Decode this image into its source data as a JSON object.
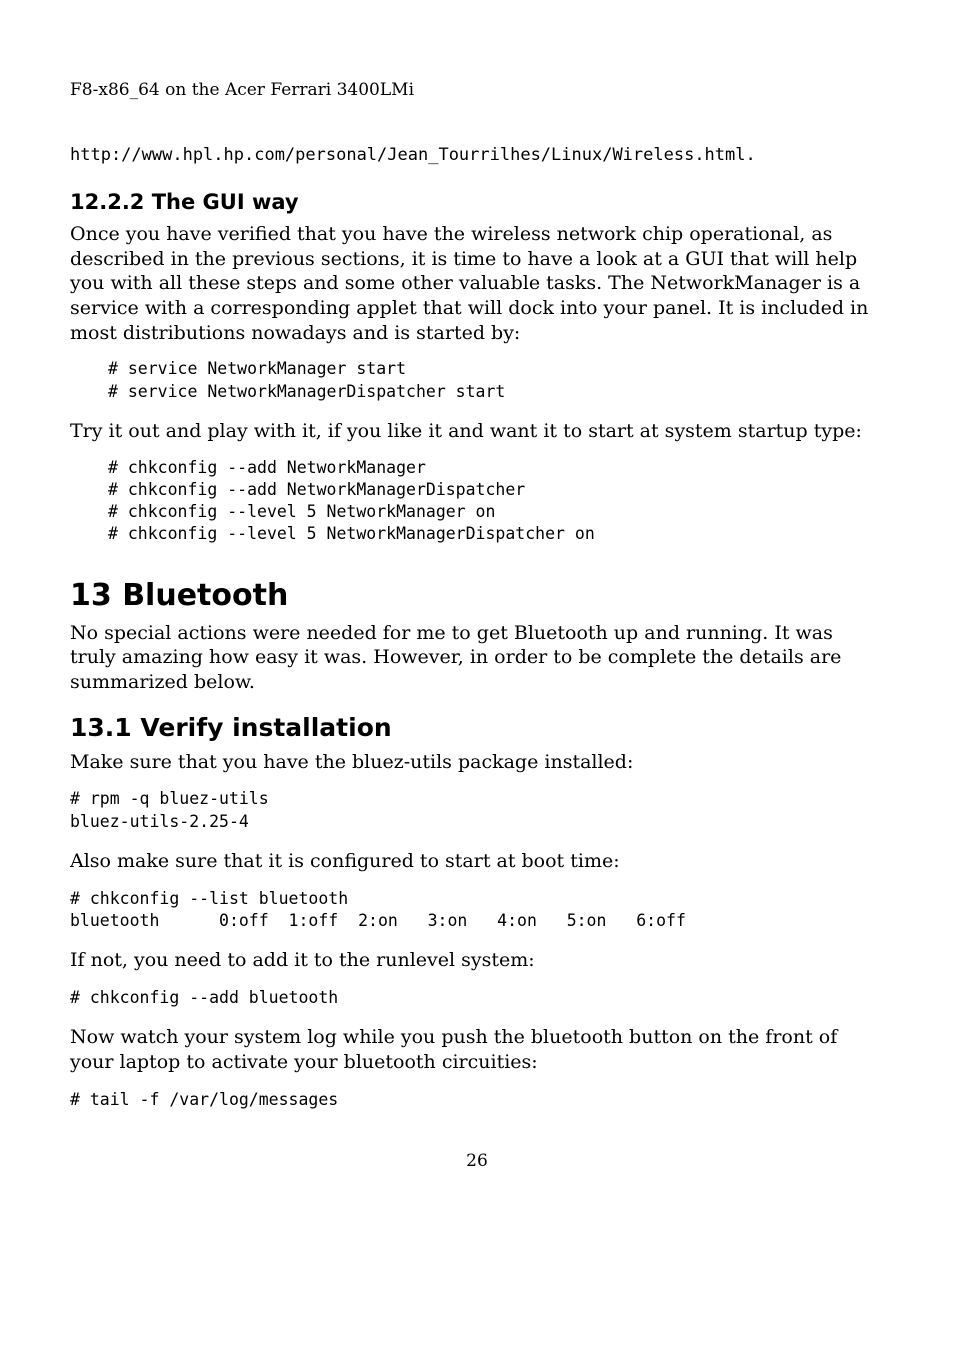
{
  "header": "F8-x86_64 on the Acer Ferrari 3400LMi",
  "url_line": "http://www.hpl.hp.com/personal/Jean_Tourrilhes/Linux/Wireless.html.",
  "section_1222": {
    "heading": " 12.2.2 The GUI way",
    "para1": "Once you have verified that you have the wireless network chip operational, as described in the previous sections, it is time to have a look at a GUI that will help you with all these steps and some other valuable tasks. The NetworkManager is a service with a corresponding applet that will dock into your panel. It is included in most distributions nowadays and is started by:",
    "code1": "# service NetworkManager start\n# service NetworkManagerDispatcher start",
    "para2": "Try it out and play with it, if you like it and want it to start at system startup type:",
    "code2": "# chkconfig --add NetworkManager\n# chkconfig --add NetworkManagerDispatcher\n# chkconfig --level 5 NetworkManager on\n# chkconfig --level 5 NetworkManagerDispatcher on"
  },
  "section_13": {
    "heading": " 13 Bluetooth",
    "para": "No special actions were needed for me to get Bluetooth up and running. It was truly amazing how easy it was. However, in order to be complete the details are summarized below."
  },
  "section_131": {
    "heading": " 13.1 Verify installation",
    "para1": "Make sure that you have the bluez-utils package installed:",
    "code1": "# rpm -q bluez-utils\nbluez-utils-2.25-4",
    "para2": "Also make sure that it is configured to start at boot time:",
    "code2": "# chkconfig --list bluetooth\nbluetooth      0:off  1:off  2:on   3:on   4:on   5:on   6:off",
    "para3": "If not, you need to add it to the runlevel system:",
    "code3": "# chkconfig --add bluetooth",
    "para4": "Now watch your system log while you push the bluetooth button on the front of your laptop to activate your bluetooth circuities:",
    "code4": "# tail -f /var/log/messages"
  },
  "page_number": "26"
}
